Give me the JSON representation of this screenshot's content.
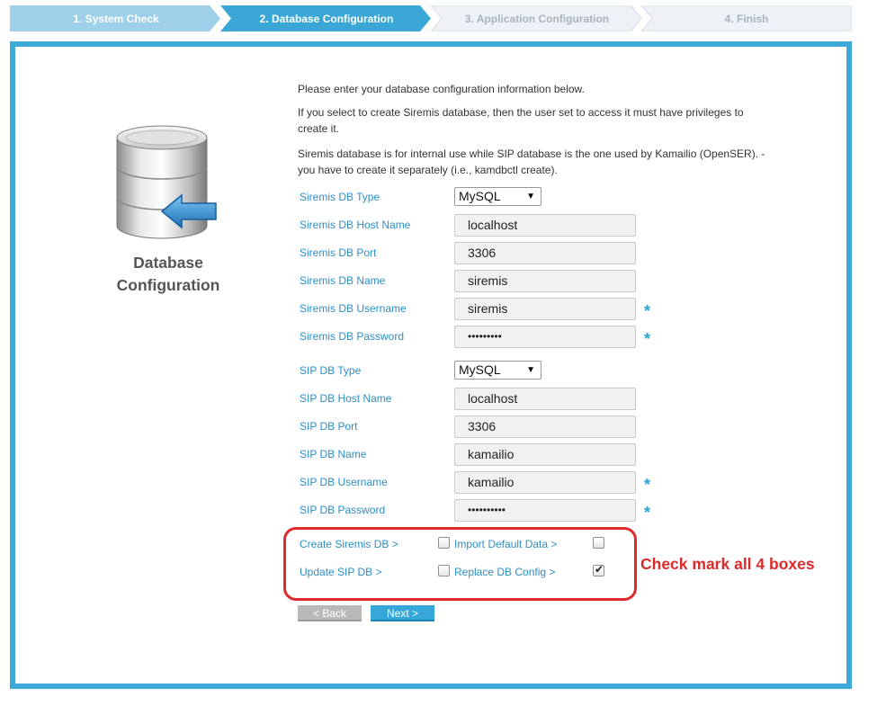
{
  "wizard": {
    "steps": [
      {
        "label": "1. System Check",
        "state": "done"
      },
      {
        "label": "2. Database Configuration",
        "state": "active"
      },
      {
        "label": "3. Application Configuration",
        "state": "todo"
      },
      {
        "label": "4. Finish",
        "state": "todo"
      }
    ]
  },
  "panel": {
    "title_line1": "Database",
    "title_line2": "Configuration",
    "intro_1": "Please enter your database configuration information below.",
    "intro_2": "If you select to create Siremis database, then the user set to access it must have privileges to create it.",
    "intro_3": "Siremis database is for internal use while SIP database is the one used by Kamailio (OpenSER). - you have to create it separately (i.e., kamdbctl create)."
  },
  "siremis": {
    "db_type_label": "Siremis DB Type",
    "db_type_value": "MySQL",
    "host_label": "Siremis DB Host Name",
    "host_value": "localhost",
    "port_label": "Siremis DB Port",
    "port_value": "3306",
    "name_label": "Siremis DB Name",
    "name_value": "siremis",
    "user_label": "Siremis DB Username",
    "user_value": "siremis",
    "pass_label": "Siremis DB Password",
    "pass_value": "•••••••••"
  },
  "sip": {
    "db_type_label": "SIP DB Type",
    "db_type_value": "MySQL",
    "host_label": "SIP DB Host Name",
    "host_value": "localhost",
    "port_label": "SIP DB Port",
    "port_value": "3306",
    "name_label": "SIP DB Name",
    "name_value": "kamailio",
    "user_label": "SIP DB Username",
    "user_value": "kamailio",
    "pass_label": "SIP DB Password",
    "pass_value": "••••••••••"
  },
  "required_mark": "*",
  "options": {
    "create_siremis_label": "Create Siremis DB >",
    "create_siremis_checked": false,
    "import_default_label": "Import Default Data >",
    "import_default_checked": false,
    "update_sip_label": "Update SIP DB >",
    "update_sip_checked": false,
    "replace_config_label": "Replace DB Config >",
    "replace_config_checked": true,
    "check_glyph": "✔"
  },
  "buttons": {
    "back": "< Back",
    "next": "Next >"
  },
  "annotation": "Check mark all 4 boxes",
  "colors": {
    "accent": "#3fa9d8",
    "label": "#2d8fc6",
    "annotation": "#d92b2b"
  }
}
